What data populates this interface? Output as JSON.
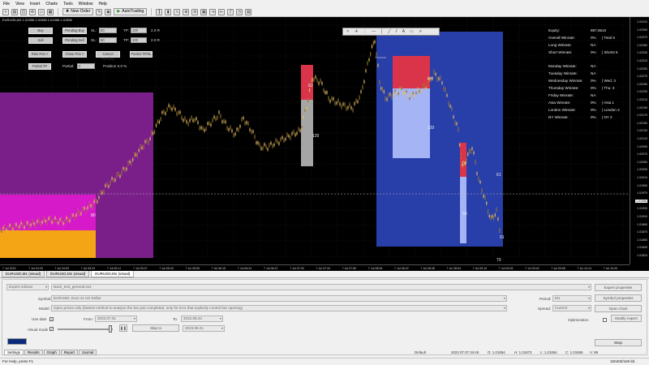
{
  "menu": [
    "File",
    "View",
    "Insert",
    "Charts",
    "Tools",
    "Window",
    "Help"
  ],
  "toolbar": {
    "new_order": "New Order",
    "autotrading": "AutoTrading"
  },
  "chart": {
    "title": "EURUSD,M1  1.01956  1.01956  1.01956  1.01956",
    "price_labels": [
      "1.02410",
      "1.02390",
      "1.02370",
      "1.02350",
      "1.02330",
      "1.02310",
      "1.02290",
      "1.02270",
      "1.02250",
      "1.02230",
      "1.02210",
      "1.02190",
      "1.02170",
      "1.02150",
      "1.02130",
      "1.02110",
      "1.02090",
      "1.02070",
      "1.02050",
      "1.02030",
      "1.02010",
      "1.01990",
      "1.01970",
      "1.01956",
      "1.01930",
      "1.01910",
      "1.01890",
      "1.01870",
      "1.01850",
      "1.01830",
      "1.01810"
    ],
    "time_labels": [
      "7 Jul 2022",
      "7 Jul 04:29",
      "7 Jul 04:53",
      "7 Jul 05:03",
      "7 Jul 05:11",
      "7 Jul 05:27",
      "7 Jul 05:43",
      "7 Jul 05:59",
      "7 Jul 06:15",
      "7 Jul 06:31",
      "7 Jul 06:47",
      "7 Jul 07:03",
      "7 Jul 07:34",
      "7 Jul 07:50",
      "7 Jul 08:06",
      "7 Jul 08:22",
      "7 Jul 08:38",
      "7 Jul 08:54",
      "7 Jul 09:10",
      "7 Jul 09:26",
      "7 Jul 09:42",
      "7 Jul 09:58",
      "7 Jul 10:14",
      "7 Jul 10:20"
    ],
    "colors": {
      "purple_zone": "#7a1f8a",
      "magenta_zone": "#d619c9",
      "orange_zone": "#f3a516",
      "gray_box": "#a6a6a6",
      "red_box": "#d9344a",
      "blue_zone": "#283ea8",
      "light_blue": "#a4b4f4",
      "candles": "#d4a645"
    },
    "zone_labels": [
      "80",
      "60",
      "120",
      "60",
      "120",
      "30",
      "50",
      "61",
      "91",
      "73"
    ]
  },
  "trade_panel": {
    "buy": "Buy",
    "sell": "Sell",
    "pending_buy": "Pending Buy",
    "pending_sell": "Pending Sell",
    "sl_label": "SL:",
    "tp_label": "TP:",
    "sl_buy": "50",
    "tp_buy": "100",
    "sl_sell": "50",
    "tp_sell": "100",
    "rr_buy": "2.0 R",
    "rr_sell": "2.0 R",
    "close_row": [
      "Rise Pos ×",
      "Close Pos ×",
      "Cancel Pending",
      "Pocket TP/SL"
    ],
    "partial_tp": "Partial TP",
    "partial_label": "Partial:",
    "partial_value": "0",
    "position_text": "Position 0.0 %"
  },
  "stats": [
    {
      "label": "Equity:",
      "value": "887.6510",
      "extra": ""
    },
    {
      "label": "Overall Winrate:",
      "value": "0%",
      "extra": "| Total 6"
    },
    {
      "label": "Long Winrate:",
      "value": "NA",
      "extra": ""
    },
    {
      "label": "Short Winrate:",
      "value": "0%",
      "extra": "| Shorts 6"
    },
    {
      "label": "",
      "value": "",
      "extra": ""
    },
    {
      "label": "Monday Winrate:",
      "value": "NA",
      "extra": ""
    },
    {
      "label": "Tuesday Winrate:",
      "value": "NA",
      "extra": ""
    },
    {
      "label": "Wednesday Winrate:",
      "value": "0%",
      "extra": "| Wed: 3"
    },
    {
      "label": "Thursday Winrate:",
      "value": "0%",
      "extra": "| Thu: 3"
    },
    {
      "label": "Friday Winrate:",
      "value": "NA",
      "extra": ""
    },
    {
      "label": "Asia Winrate:",
      "value": "0%",
      "extra": "| Asia 1"
    },
    {
      "label": "London Winrate:",
      "value": "0%",
      "extra": "| London 2"
    },
    {
      "label": "NY Winrate:",
      "value": "0%",
      "extra": "| NY 2"
    }
  ],
  "chart_tabs": [
    "EURUSD,M1 (visual)",
    "EURUSD,M1 (visual)",
    "EURUSD,M1 (visual)"
  ],
  "tester": {
    "type": "Expert Advisor",
    "expert_file": "Back_test_general.ex4",
    "symbol_label": "Symbol:",
    "symbol_value": "EURUSD, Euro vs US Dollar",
    "model_label": "Model:",
    "model_value": "Open prices only (fastest method to analyze the bar just completed, only for EAs that explicitly control bar opening)",
    "use_date": "Use date",
    "from_label": "From:",
    "from_value": "2022.07.01",
    "to_label": "To:",
    "to_value": "2022.08.24",
    "visual_mode": "Visual mode",
    "skip_to": "Skip to",
    "skip_date": "2023.08.21",
    "period_label": "Period:",
    "period_value": "M1",
    "spread_label": "Spread:",
    "spread_value": "Current",
    "optimization": "Optimization",
    "btn_expert_props": "Expert properties",
    "btn_symbol_props": "Symbol properties",
    "btn_open_chart": "Open chart",
    "btn_modify_expert": "Modify expert",
    "btn_stop": "Stop",
    "progress_fraction": 0.98,
    "tabs": [
      "Settings",
      "Results",
      "Graph",
      "Report",
      "Journal"
    ],
    "bar_status": [
      "Default",
      "2022.07.07 04:49",
      "O: 1.01854",
      "H: 1.01873",
      "L: 1.01854",
      "C: 1.01869",
      "V: 89"
    ]
  },
  "statusbar": {
    "help": "For Help, press F1",
    "memory": "150400/160 kb"
  }
}
